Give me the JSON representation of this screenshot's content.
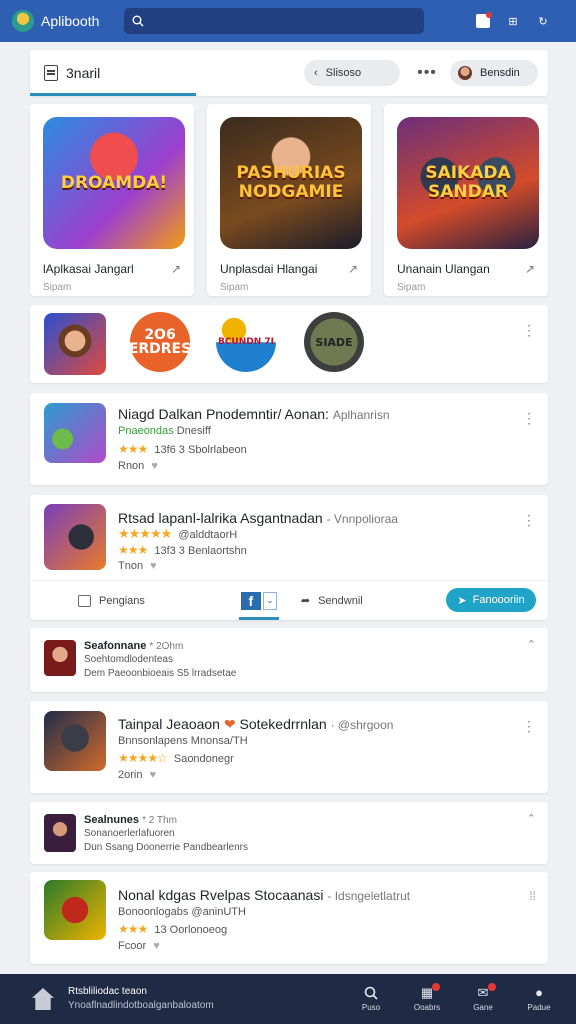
{
  "app": {
    "title": "Aplibooth"
  },
  "header": {
    "title": "3naril",
    "back_label": "Slisoso",
    "user_label": "Bensdin"
  },
  "featured": [
    {
      "art_text": "DROAMDA!",
      "title": "lAplkasai Jangarl",
      "sub": "Sipam"
    },
    {
      "art_text": "PASHURIAS NODGAMIE",
      "title": "Unplasdai Hlangai",
      "sub": "Sipam"
    },
    {
      "art_text": "SAIKADA SANDAR",
      "title": "Unanain Ulangan",
      "sub": "Sipam"
    }
  ],
  "icon_row": [
    {
      "label": ""
    },
    {
      "label": "2O6 ERDRES"
    },
    {
      "label": "BCUNDN 7I"
    },
    {
      "label": "SIADE"
    }
  ],
  "list": [
    {
      "title": "Niagd Dalkan Pnodemntir/ Aonan:",
      "title_muted": "Aplhanrisn",
      "line2_green": "Pnaeondas",
      "line2": "Dnesiff",
      "rating_stars": "★★★",
      "rating_text": "13f6 3 Sbolrlabeon",
      "meta": "Rnon"
    },
    {
      "title": "Rtsad lapanl-lalrika Asgantnadan",
      "title_muted": "- Vnnpolioraa",
      "stars_big": "★★★★★",
      "line2": "@alddtaorH",
      "rating_stars": "★★★",
      "rating_text": "13f3 3 Benlaortshn",
      "meta": "Tnon",
      "actions": {
        "save": "Pengians",
        "fb": "f",
        "share": "Sendwnil",
        "cta": "Fanoooriin"
      }
    },
    {
      "title": "Seafonnane",
      "time": "* 2Ohm",
      "line2": "Soehtomdlodenteas",
      "line3": "Dem Paeoonbioeais S5 lrradsetae"
    },
    {
      "title": "Tainpal Jeaoaon",
      "title_tail": "Sotekedrrnlan",
      "title_muted": "· @shrgoon",
      "line2": "Bnnsonlapens Mnonsa/TH",
      "rating_stars": "★★★★☆",
      "rating_text": "Saondonegr",
      "meta": "2orin"
    },
    {
      "title": "Sealnunes",
      "time": "* 2 Thm",
      "line2": "Sonanoerlerlafuoren",
      "line3": "Dun Ssang Doonerrie Pandbearlenrs"
    },
    {
      "title": "Nonal kdgas Rvelpas Stocaanasi",
      "title_muted": "- Idsngeletlatrut",
      "line2": "Bonoonlogabs @aninUTH",
      "rating_stars": "★★★",
      "rating_text": "13 Oorlonoeog",
      "meta": "Fcoor"
    }
  ],
  "bottom_nav": {
    "title": "Rtsbliliodac teaon",
    "sub": "Ynoaflnadlindotboalganbaloatom",
    "tabs": [
      "Puso",
      "Ooabrs",
      "Gane",
      "Padue"
    ]
  }
}
